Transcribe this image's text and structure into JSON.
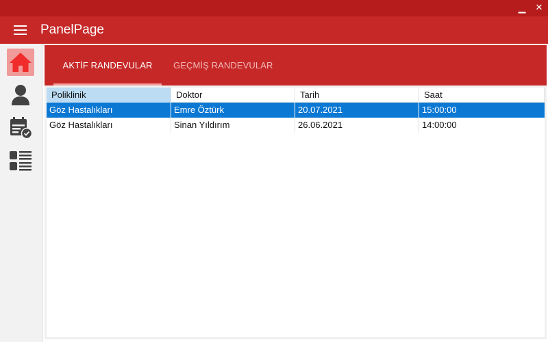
{
  "window": {
    "minimize_icon": "minimize-icon",
    "close_icon": "close-icon",
    "minimize_glyph": "▁",
    "close_glyph": "✕"
  },
  "appbar": {
    "title": "PanelPage",
    "menu_icon": "hamburger-menu-icon"
  },
  "sidebar": {
    "items": [
      {
        "icon": "home-icon",
        "active": true
      },
      {
        "icon": "user-icon",
        "active": false
      },
      {
        "icon": "calendar-check-icon",
        "active": false
      },
      {
        "icon": "list-icon",
        "active": false
      }
    ]
  },
  "tabs": [
    {
      "label": "AKTİF RANDEVULAR",
      "active": true
    },
    {
      "label": "GEÇMİŞ RANDEVULAR",
      "active": false
    }
  ],
  "table": {
    "columns": [
      "Poliklinik",
      "Doktor",
      "Tarih",
      "Saat"
    ],
    "rows": [
      [
        "Göz Hastalıkları",
        "Emre Öztürk",
        "20.07.2021",
        "15:00:00"
      ],
      [
        "Göz Hastalıkları",
        "Sinan Yıldırım",
        "26.06.2021",
        "14:00:00"
      ]
    ],
    "selected_row": 0,
    "sorted_column": 0
  },
  "colors": {
    "titlebar": "#b71c1c",
    "primary": "#c62828",
    "active_sidebar": "#f19a9a",
    "icon_dark": "#424242",
    "selection": "#0b78d4",
    "sorted_header": "#bcdcf4"
  }
}
